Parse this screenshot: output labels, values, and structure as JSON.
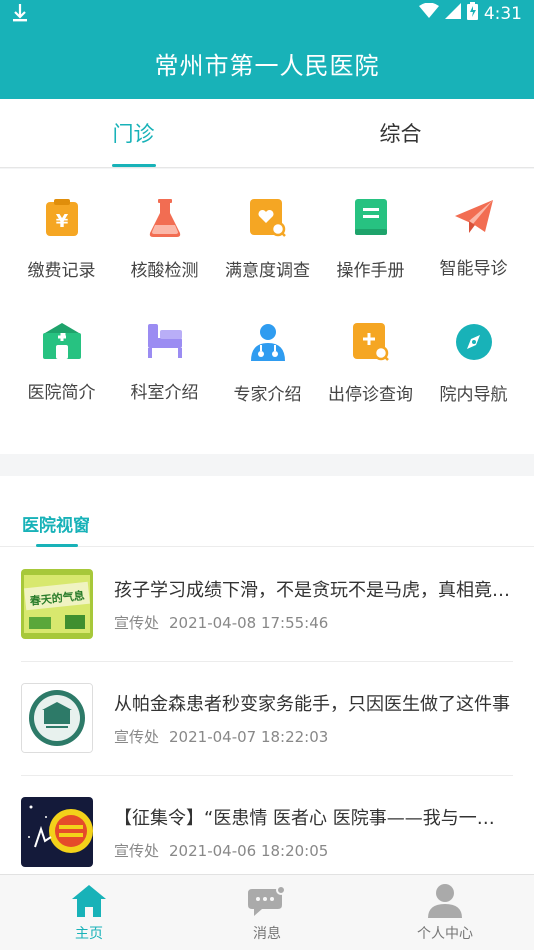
{
  "status_bar": {
    "time": "4:31",
    "icons": [
      "download-icon",
      "wifi-icon",
      "signal-icon",
      "battery-icon"
    ]
  },
  "header": {
    "title": "常州市第一人民医院"
  },
  "tabs": [
    {
      "label": "门诊",
      "active": true
    },
    {
      "label": "综合",
      "active": false
    }
  ],
  "services": [
    {
      "label": "缴费记录",
      "icon": "payment-record-icon",
      "color": "#f5a623"
    },
    {
      "label": "核酸检测",
      "icon": "flask-icon",
      "color": "#f26d52"
    },
    {
      "label": "满意度调查",
      "icon": "survey-icon",
      "color": "#f5a623"
    },
    {
      "label": "操作手册",
      "icon": "manual-book-icon",
      "color": "#27c281"
    },
    {
      "label": "智能导诊",
      "icon": "paper-plane-icon",
      "color": "#f26d52"
    },
    {
      "label": "医院简介",
      "icon": "hospital-icon",
      "color": "#27c281"
    },
    {
      "label": "科室介绍",
      "icon": "department-bed-icon",
      "color": "#9b8cf2"
    },
    {
      "label": "专家介绍",
      "icon": "doctor-icon",
      "color": "#2f9cf0"
    },
    {
      "label": "出停诊查询",
      "icon": "schedule-search-icon",
      "color": "#f5a623"
    },
    {
      "label": "院内导航",
      "icon": "compass-icon",
      "color": "#18b2b8"
    }
  ],
  "news": {
    "section_title": "医院视窗",
    "items": [
      {
        "title": "孩子学习成绩下滑，不是贪玩不是马虎，真相竟然是",
        "source": "宣传处",
        "time": "2021-04-08 17:55:46",
        "thumb_text": "春天的气息"
      },
      {
        "title": "从帕金森患者秒变家务能手，只因医生做了这件事",
        "source": "宣传处",
        "time": "2021-04-07 18:22:03",
        "thumb_text": ""
      },
      {
        "title": "【征集令】“医患情 医者心 医院事——我与一院的故事”",
        "source": "宣传处",
        "time": "2021-04-06 18:20:05",
        "thumb_text": ""
      }
    ]
  },
  "bottom_nav": [
    {
      "label": "主页",
      "icon": "home-icon",
      "active": true
    },
    {
      "label": "消息",
      "icon": "chat-bubble-icon",
      "active": false
    },
    {
      "label": "个人中心",
      "icon": "person-icon",
      "active": false
    }
  ],
  "colors": {
    "primary": "#18b2b8",
    "text": "#333333",
    "muted": "#888888"
  }
}
